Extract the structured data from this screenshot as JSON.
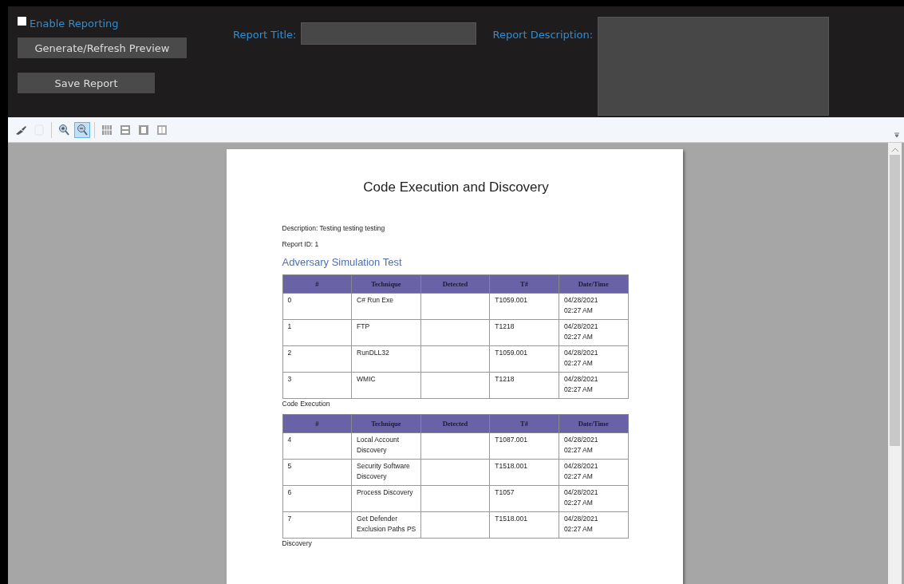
{
  "controls": {
    "enable_reporting": {
      "label": "Enable Reporting",
      "checked": false
    },
    "generate_button": "Generate/Refresh Preview",
    "save_button": "Save Report",
    "report_title": {
      "label": "Report Title:"
    },
    "report_description": {
      "label": "Report Description:"
    }
  },
  "toolbar": [
    {
      "kind": "print",
      "selected": false,
      "disabled": false
    },
    {
      "kind": "page",
      "selected": false,
      "disabled": true
    },
    {
      "kind": "zoom-in",
      "selected": false,
      "disabled": false
    },
    {
      "kind": "zoom-out",
      "selected": true,
      "disabled": false
    },
    {
      "kind": "grid",
      "selected": false,
      "disabled": false
    },
    {
      "kind": "split",
      "selected": false,
      "disabled": false
    },
    {
      "kind": "single",
      "selected": false,
      "disabled": false
    },
    {
      "kind": "double",
      "selected": false,
      "disabled": false
    }
  ],
  "document": {
    "title": "Code Execution and Discovery",
    "description": "Description: Testing testing testing",
    "report_id": "Report ID: 1",
    "heading": "Adversary Simulation Test",
    "tables": [
      {
        "columns": [
          "#",
          "Technique",
          "Detected",
          "T#",
          "Date/Time"
        ],
        "rows": [
          [
            "0",
            "C# Run Exe",
            "",
            "T1059.001",
            "04/28/2021 02:27 AM"
          ],
          [
            "1",
            "FTP",
            "",
            "T1218",
            "04/28/2021 02:27 AM"
          ],
          [
            "2",
            "RunDLL32",
            "",
            "T1059.001",
            "04/28/2021 02:27 AM"
          ],
          [
            "3",
            "WMIC",
            "",
            "T1218",
            "04/28/2021 02:27 AM"
          ]
        ],
        "caption": "Code Execution"
      },
      {
        "columns": [
          "#",
          "Technique",
          "Detected",
          "T#",
          "Date/Time"
        ],
        "rows": [
          [
            "4",
            "Local Account Discovery",
            "",
            "T1087.001",
            "04/28/2021 02:27 AM"
          ],
          [
            "5",
            "Security Software Discovery",
            "",
            "T1518.001",
            "04/28/2021 02:27 AM"
          ],
          [
            "6",
            "Process Discovery",
            "",
            "T1057",
            "04/28/2021 02:27 AM"
          ],
          [
            "7",
            "Get Defender Exclusion Paths PS",
            "",
            "T1518.001",
            "04/28/2021 02:27 AM"
          ]
        ],
        "caption": "Discovery"
      }
    ]
  }
}
